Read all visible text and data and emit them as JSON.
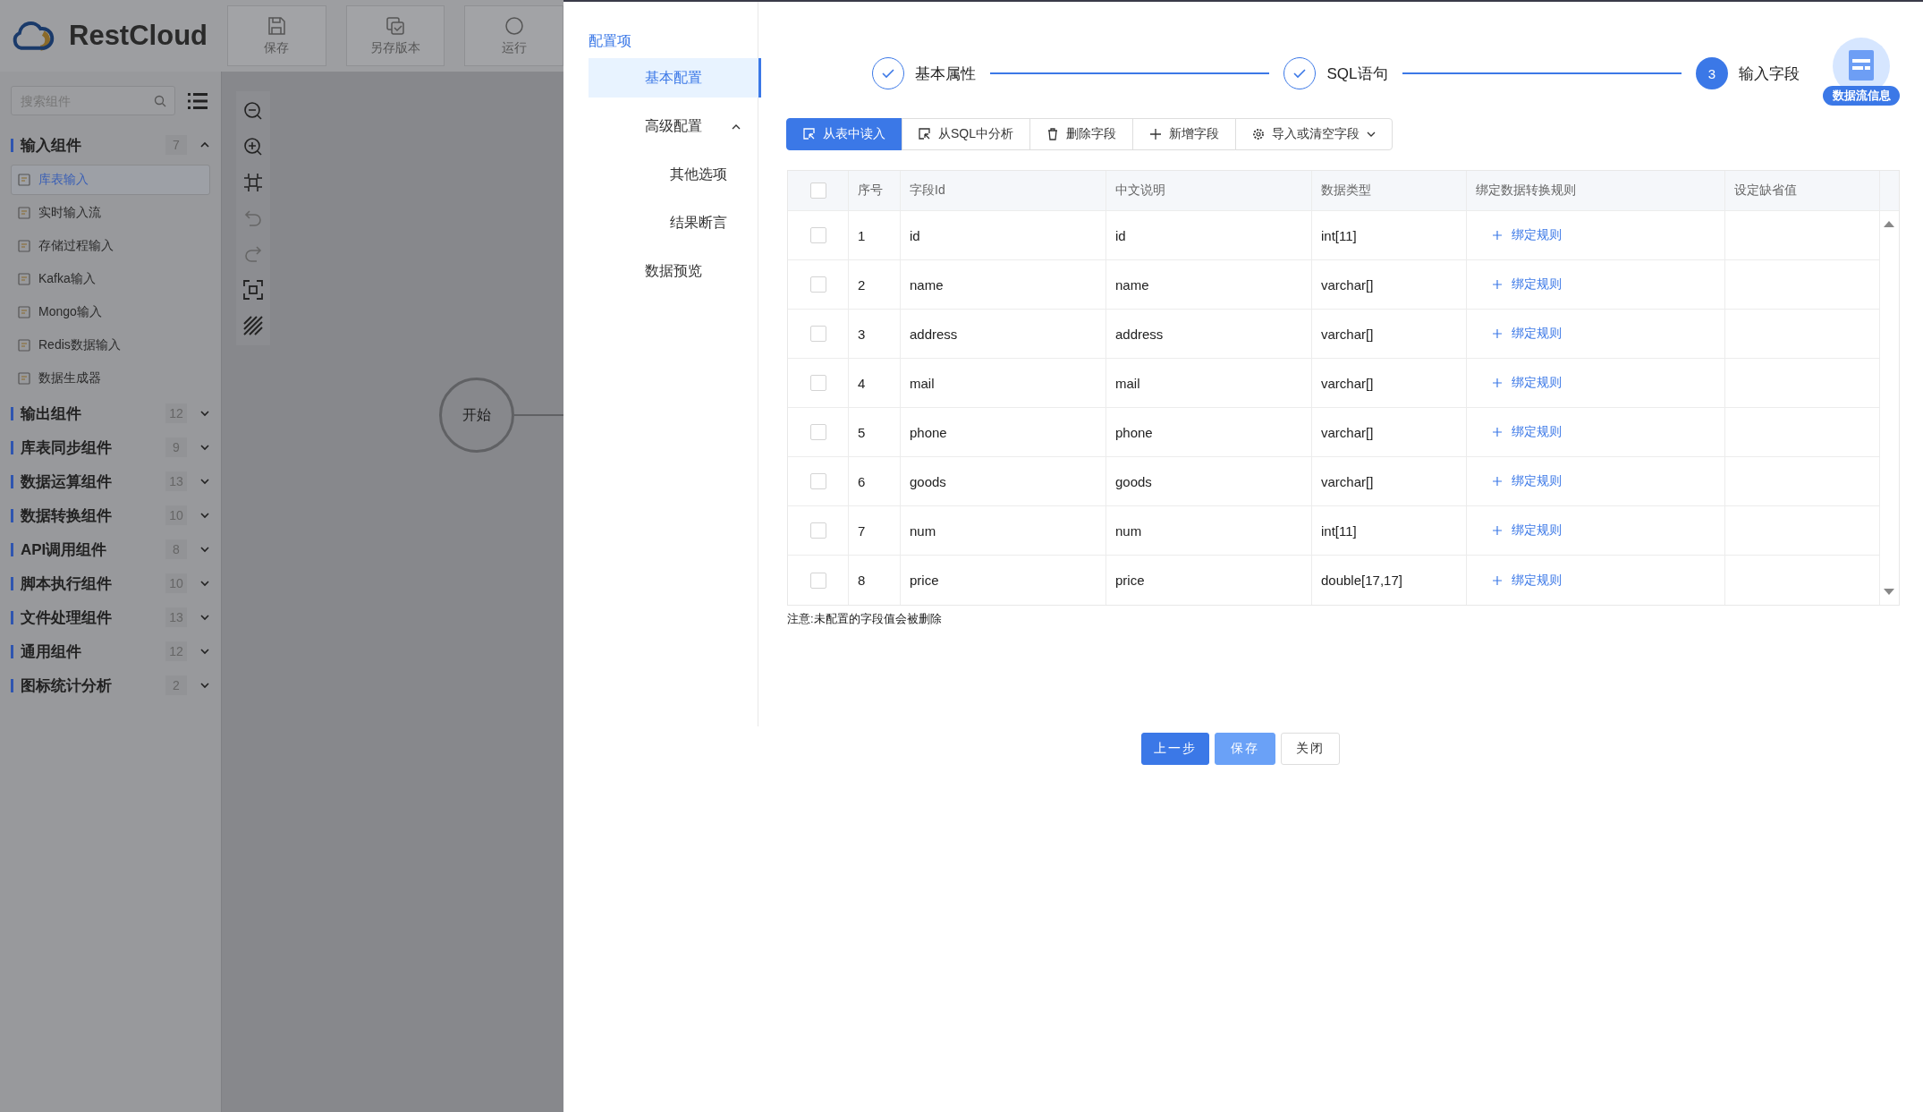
{
  "app": {
    "logo": "RestCloud",
    "toolbar": [
      {
        "label": "保存"
      },
      {
        "label": "另存版本"
      },
      {
        "label": "运行"
      }
    ]
  },
  "sidebar": {
    "search": {
      "placeholder": "搜索组件"
    },
    "groups": [
      {
        "label": "输入组件",
        "count": "7",
        "expanded": true,
        "items": [
          {
            "label": "库表输入",
            "selected": true
          },
          {
            "label": "实时输入流",
            "selected": false
          },
          {
            "label": "存储过程输入",
            "selected": false
          },
          {
            "label": "Kafka输入",
            "selected": false
          },
          {
            "label": "Mongo输入",
            "selected": false
          },
          {
            "label": "Redis数据输入",
            "selected": false
          },
          {
            "label": "数据生成器",
            "selected": false
          }
        ]
      },
      {
        "label": "输出组件",
        "count": "12",
        "expanded": false
      },
      {
        "label": "库表同步组件",
        "count": "9",
        "expanded": false
      },
      {
        "label": "数据运算组件",
        "count": "13",
        "expanded": false
      },
      {
        "label": "数据转换组件",
        "count": "10",
        "expanded": false
      },
      {
        "label": "API调用组件",
        "count": "8",
        "expanded": false
      },
      {
        "label": "脚本执行组件",
        "count": "10",
        "expanded": false
      },
      {
        "label": "文件处理组件",
        "count": "13",
        "expanded": false
      },
      {
        "label": "通用组件",
        "count": "12",
        "expanded": false
      },
      {
        "label": "图标统计分析",
        "count": "2",
        "expanded": false
      }
    ]
  },
  "canvas": {
    "start_node": "开始"
  },
  "drawer": {
    "section_title": "配置项",
    "nav": [
      {
        "label": "基本配置",
        "selected": true
      },
      {
        "label": "高级配置",
        "selected": false,
        "expanded": true,
        "children": [
          {
            "label": "其他选项",
            "selected": false
          },
          {
            "label": "结果断言",
            "selected": false
          }
        ]
      },
      {
        "label": "数据预览",
        "selected": false
      }
    ],
    "steps": [
      {
        "label": "基本属性",
        "kind": "done"
      },
      {
        "label": "SQL语句",
        "kind": "done"
      },
      {
        "label": "输入字段",
        "kind": "current",
        "number": "3"
      }
    ],
    "badge": "数据流信息",
    "actions": [
      {
        "label": "从表中读入",
        "kind": "primary"
      },
      {
        "label": "从SQL中分析",
        "kind": "default"
      },
      {
        "label": "删除字段",
        "kind": "default"
      },
      {
        "label": "新增字段",
        "kind": "default"
      },
      {
        "label": "导入或清空字段",
        "kind": "dropdown"
      }
    ],
    "table": {
      "columns": [
        "序号",
        "字段Id",
        "中文说明",
        "数据类型",
        "绑定数据转换规则",
        "设定缺省值"
      ],
      "rows": [
        {
          "checked": false,
          "no": "1",
          "field": "id",
          "desc": "id",
          "type": "int[11]",
          "action": "绑定规则"
        },
        {
          "checked": false,
          "no": "2",
          "field": "name",
          "desc": "name",
          "type": "varchar[]",
          "action": "绑定规则"
        },
        {
          "checked": false,
          "no": "3",
          "field": "address",
          "desc": "address",
          "type": "varchar[]",
          "action": "绑定规则"
        },
        {
          "checked": false,
          "no": "4",
          "field": "mail",
          "desc": "mail",
          "type": "varchar[]",
          "action": "绑定规则"
        },
        {
          "checked": false,
          "no": "5",
          "field": "phone",
          "desc": "phone",
          "type": "varchar[]",
          "action": "绑定规则"
        },
        {
          "checked": false,
          "no": "6",
          "field": "goods",
          "desc": "goods",
          "type": "varchar[]",
          "action": "绑定规则"
        },
        {
          "checked": false,
          "no": "7",
          "field": "num",
          "desc": "num",
          "type": "int[11]",
          "action": "绑定规则"
        },
        {
          "checked": false,
          "no": "8",
          "field": "price",
          "desc": "price",
          "type": "double[17,17]",
          "action": "绑定规则"
        }
      ],
      "all_checked": false
    },
    "note": "注意:未配置的字段值会被删除",
    "buttons": [
      {
        "label": "上一步",
        "kind": "primary"
      },
      {
        "label": "保存",
        "kind": "light"
      },
      {
        "label": "关闭",
        "kind": "default"
      }
    ]
  }
}
